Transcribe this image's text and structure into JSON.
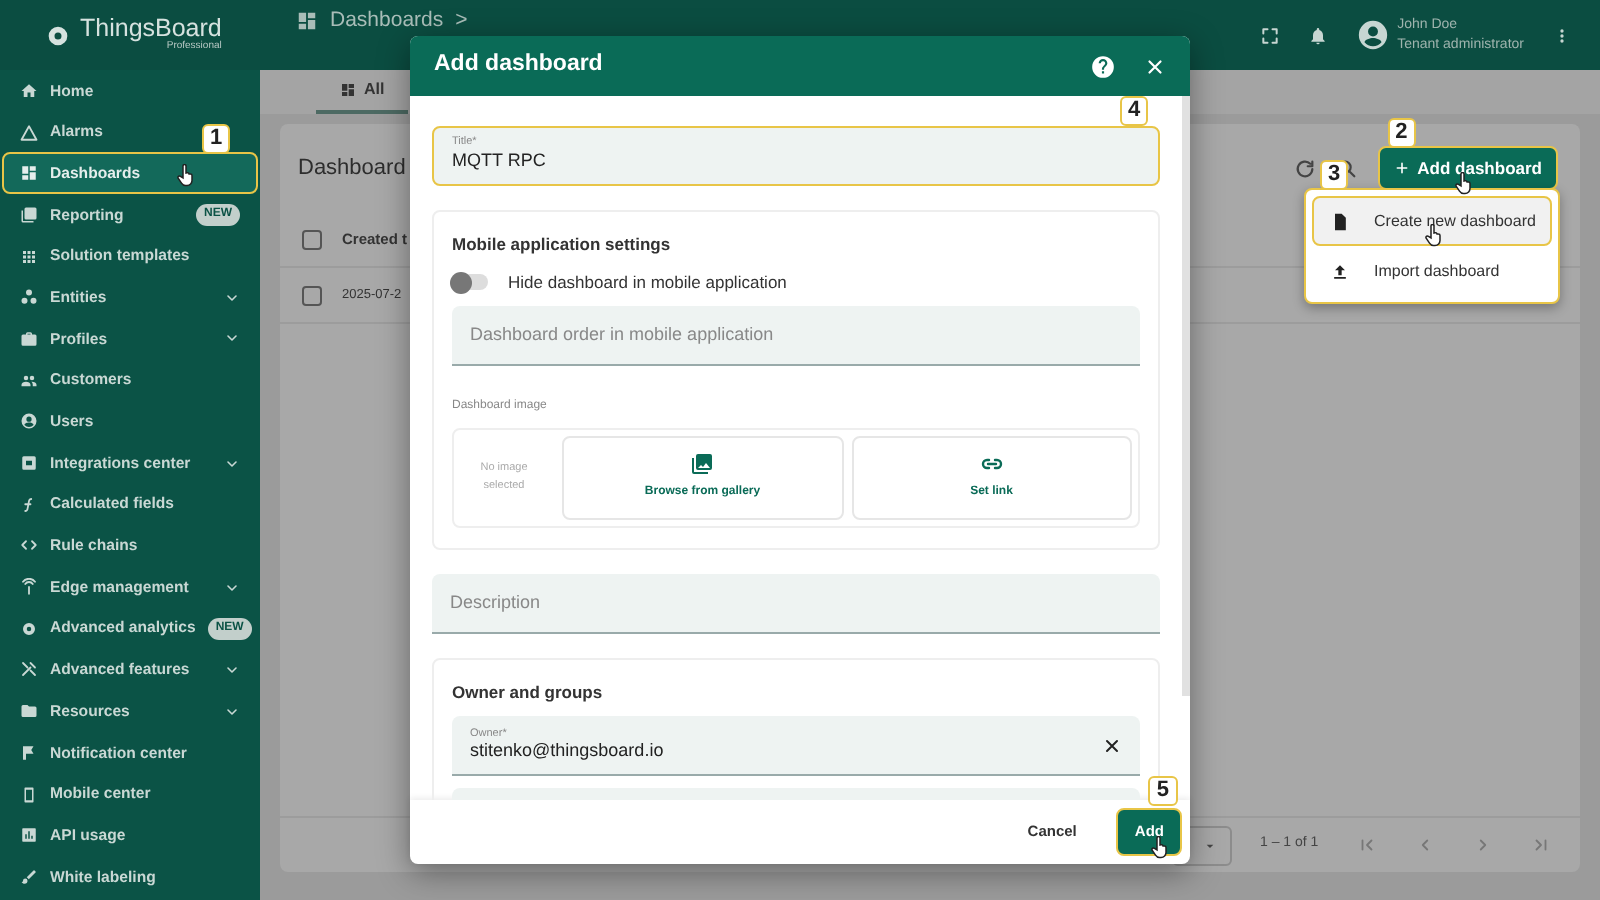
{
  "topbar": {
    "logo": "ThingsBoard",
    "edition": "Professional",
    "breadcrumb": [
      "Dashboards",
      ">"
    ],
    "user": {
      "name": "John Doe",
      "role": "Tenant administrator"
    }
  },
  "sidebar": {
    "items": [
      {
        "label": "Home",
        "selected": false,
        "expandable": false
      },
      {
        "label": "Alarms",
        "selected": false,
        "expandable": false
      },
      {
        "label": "Dashboards",
        "selected": true,
        "expandable": false,
        "callout": "1",
        "pointer": true
      },
      {
        "label": "Reporting",
        "selected": false,
        "expandable": false,
        "badge": "NEW"
      },
      {
        "label": "Solution templates",
        "selected": false,
        "expandable": false
      },
      {
        "label": "Entities",
        "selected": false,
        "expandable": true
      },
      {
        "label": "Profiles",
        "selected": false,
        "expandable": true
      },
      {
        "label": "Customers",
        "selected": false,
        "expandable": false
      },
      {
        "label": "Users",
        "selected": false,
        "expandable": false
      },
      {
        "label": "Integrations center",
        "selected": false,
        "expandable": true
      },
      {
        "label": "Calculated fields",
        "selected": false,
        "expandable": false
      },
      {
        "label": "Rule chains",
        "selected": false,
        "expandable": false
      },
      {
        "label": "Edge management",
        "selected": false,
        "expandable": true
      },
      {
        "label": "Advanced analytics",
        "selected": false,
        "expandable": false,
        "badge": "NEW"
      },
      {
        "label": "Advanced features",
        "selected": false,
        "expandable": true
      },
      {
        "label": "Resources",
        "selected": false,
        "expandable": true
      },
      {
        "label": "Notification center",
        "selected": false,
        "expandable": false
      },
      {
        "label": "Mobile center",
        "selected": false,
        "expandable": false
      },
      {
        "label": "API usage",
        "selected": false,
        "expandable": false
      },
      {
        "label": "White labeling",
        "selected": false,
        "expandable": false
      }
    ]
  },
  "tabs": [
    {
      "label": "All",
      "selected": true
    }
  ],
  "card": {
    "title": "Dashboard",
    "add_button": {
      "label": "Add dashboard",
      "callout": "2",
      "pointer": true
    },
    "header_checked": false,
    "columns": [
      "Created t"
    ],
    "rows": [
      {
        "cells": [
          "2025-07-2"
        ],
        "checked": false
      }
    ],
    "paging": "1 – 1 of 1"
  },
  "menu": {
    "callout": "3",
    "items": [
      {
        "label": "Create new dashboard",
        "selected": true,
        "pointer": true
      },
      {
        "label": "Import dashboard",
        "selected": false
      }
    ]
  },
  "dialog": {
    "title": "Add dashboard",
    "title_field": {
      "label": "Title*",
      "value": "MQTT RPC",
      "callout": "4"
    },
    "mobile": {
      "heading": "Mobile application settings",
      "toggle": {
        "label": "Hide dashboard in mobile application",
        "on": false
      },
      "order_placeholder": "Dashboard order in mobile application",
      "image_label": "Dashboard image",
      "no_image": "No image selected",
      "gallery": "Browse from gallery",
      "set_link": "Set link"
    },
    "description_placeholder": "Description",
    "owner": {
      "heading": "Owner and groups",
      "label": "Owner*",
      "value": "stitenko@thingsboard.io"
    },
    "buttons": {
      "cancel": "Cancel",
      "add": {
        "label": "Add",
        "callout": "5",
        "pointer": true
      }
    }
  }
}
